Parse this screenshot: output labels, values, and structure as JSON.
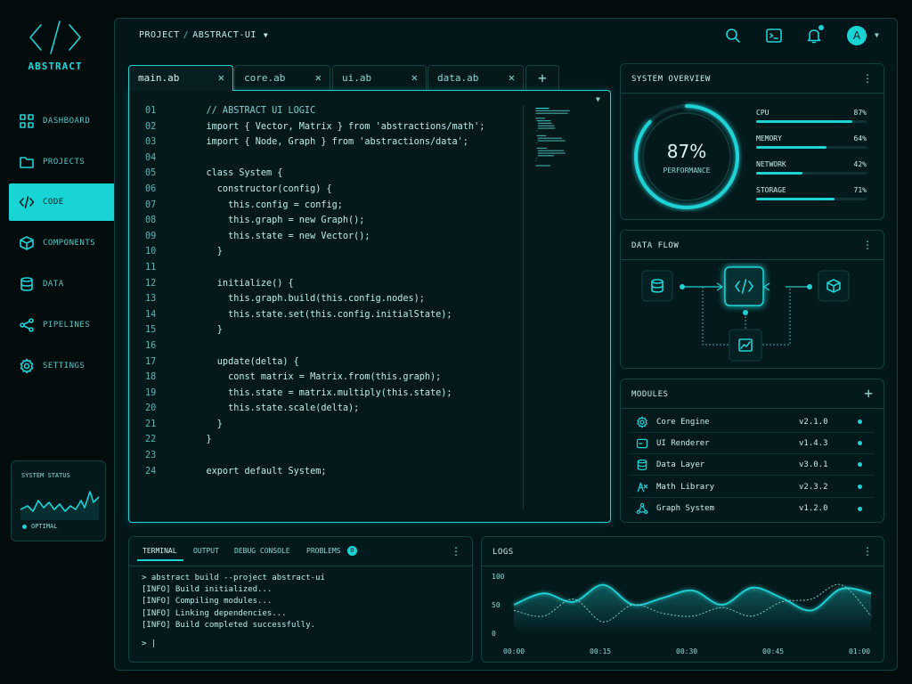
{
  "app": {
    "logo_text": "ABSTRACT"
  },
  "sidebar": {
    "items": [
      {
        "label": "DASHBOARD",
        "icon": "grid-icon"
      },
      {
        "label": "PROJECTS",
        "icon": "folder-icon"
      },
      {
        "label": "CODE",
        "icon": "code-icon",
        "active": true
      },
      {
        "label": "COMPONENTS",
        "icon": "cube-icon"
      },
      {
        "label": "DATA",
        "icon": "database-icon"
      },
      {
        "label": "PIPELINES",
        "icon": "share-nodes-icon"
      },
      {
        "label": "SETTINGS",
        "icon": "gear-icon"
      }
    ],
    "status": {
      "title": "SYSTEM STATUS",
      "value": "OPTIMAL"
    }
  },
  "header": {
    "breadcrumb": {
      "project": "PROJECT",
      "separator": "/",
      "current": "ABSTRACT-UI"
    },
    "avatar_initial": "A",
    "icons": [
      "search-icon",
      "terminal-icon",
      "bell-icon",
      "chevron-down-icon"
    ]
  },
  "editor": {
    "tabs": [
      {
        "label": "main.ab",
        "active": true
      },
      {
        "label": "core.ab"
      },
      {
        "label": "ui.ab"
      },
      {
        "label": "data.ab"
      }
    ],
    "add_tab": "+",
    "lines": [
      {
        "n": "01",
        "text": "    // ABSTRACT UI LOGIC",
        "comment": true
      },
      {
        "n": "02",
        "text": "    import { Vector, Matrix } from 'abstractions/math';"
      },
      {
        "n": "03",
        "text": "    import { Node, Graph } from 'abstractions/data';"
      },
      {
        "n": "04",
        "text": ""
      },
      {
        "n": "05",
        "text": "    class System {"
      },
      {
        "n": "06",
        "text": "      constructor(config) {"
      },
      {
        "n": "07",
        "text": "        this.config = config;"
      },
      {
        "n": "08",
        "text": "        this.graph = new Graph();"
      },
      {
        "n": "09",
        "text": "        this.state = new Vector();"
      },
      {
        "n": "10",
        "text": "      }"
      },
      {
        "n": "11",
        "text": ""
      },
      {
        "n": "12",
        "text": "      initialize() {"
      },
      {
        "n": "13",
        "text": "        this.graph.build(this.config.nodes);"
      },
      {
        "n": "14",
        "text": "        this.state.set(this.config.initialState);"
      },
      {
        "n": "15",
        "text": "      }"
      },
      {
        "n": "16",
        "text": ""
      },
      {
        "n": "17",
        "text": "      update(delta) {"
      },
      {
        "n": "18",
        "text": "        const matrix = Matrix.from(this.graph);"
      },
      {
        "n": "19",
        "text": "        this.state = matrix.multiply(this.state);"
      },
      {
        "n": "20",
        "text": "        this.state.scale(delta);"
      },
      {
        "n": "21",
        "text": "      }"
      },
      {
        "n": "22",
        "text": "    }"
      },
      {
        "n": "23",
        "text": ""
      },
      {
        "n": "24",
        "text": "    export default System;"
      }
    ]
  },
  "overview": {
    "title": "SYSTEM OVERVIEW",
    "performance": {
      "value": "87%",
      "label": "PERFORMANCE",
      "fraction": 0.87
    },
    "stats": [
      {
        "label": "CPU",
        "value": "87%",
        "fraction": 0.87
      },
      {
        "label": "MEMORY",
        "value": "64%",
        "fraction": 0.64
      },
      {
        "label": "NETWORK",
        "value": "42%",
        "fraction": 0.42
      },
      {
        "label": "STORAGE",
        "value": "71%",
        "fraction": 0.71
      }
    ]
  },
  "dataflow": {
    "title": "DATA FLOW",
    "nodes": [
      "database-icon",
      "code-icon",
      "cube-icon",
      "chart-icon"
    ]
  },
  "modules": {
    "title": "MODULES",
    "add": "+",
    "items": [
      {
        "name": "Core Engine",
        "version": "v2.1.0",
        "icon": "gear-icon"
      },
      {
        "name": "UI Renderer",
        "version": "v1.4.3",
        "icon": "window-icon"
      },
      {
        "name": "Data Layer",
        "version": "v3.0.1",
        "icon": "database-icon"
      },
      {
        "name": "Math Library",
        "version": "v2.3.2",
        "icon": "formula-icon"
      },
      {
        "name": "Graph System",
        "version": "v1.2.0",
        "icon": "graph-icon"
      }
    ]
  },
  "terminal": {
    "tabs": [
      "TERMINAL",
      "OUTPUT",
      "DEBUG CONSOLE",
      "PROBLEMS"
    ],
    "problems_count": "0",
    "lines": [
      "> abstract build --project abstract-ui",
      "[INFO] Build initialized...",
      "[INFO] Compiling modules...",
      "[INFO] Linking dependencies...",
      "[INFO] Build completed successfully."
    ],
    "prompt": "> |"
  },
  "logs": {
    "title": "LOGS",
    "y_ticks": [
      "100",
      "50",
      "0"
    ],
    "x_ticks": [
      "00:00",
      "00:15",
      "00:30",
      "00:45",
      "01:00"
    ]
  },
  "colors": {
    "accent": "#1fd2d6",
    "background": "#020c0d",
    "panel": "#04191b",
    "border": "#14403f"
  },
  "chart_data": {
    "type": "line",
    "x": [
      "00:00",
      "00:05",
      "00:10",
      "00:15",
      "00:20",
      "00:25",
      "00:30",
      "00:35",
      "00:40",
      "00:45",
      "00:50",
      "00:55",
      "01:00"
    ],
    "series": [
      {
        "values": [
          50,
          70,
          55,
          85,
          50,
          62,
          75,
          50,
          80,
          62,
          40,
          78,
          70
        ]
      },
      {
        "values": [
          40,
          30,
          60,
          20,
          50,
          35,
          30,
          45,
          30,
          55,
          60,
          85,
          30
        ]
      }
    ],
    "ylim": [
      0,
      100
    ],
    "y_ticks": [
      0,
      50,
      100
    ],
    "grid": false
  }
}
